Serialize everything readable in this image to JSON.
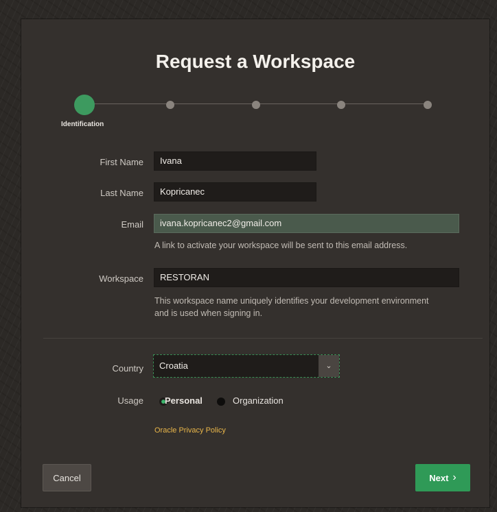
{
  "dialog": {
    "title": "Request a Workspace"
  },
  "wizard": {
    "current_step_label": "Identification",
    "total_steps": 5,
    "current_step": 1
  },
  "form": {
    "first_name": {
      "label": "First Name",
      "value": "Ivana"
    },
    "last_name": {
      "label": "Last Name",
      "value": "Kopricanec"
    },
    "email": {
      "label": "Email",
      "value": "ivana.kopricanec2@gmail.com",
      "help": "A link to activate your workspace will be sent to this email address."
    },
    "workspace": {
      "label": "Workspace",
      "value": "RESTORAN",
      "help_line1": "This workspace name uniquely identifies your development environment",
      "help_line2": "and is used when signing in."
    },
    "country": {
      "label": "Country",
      "value": "Croatia"
    },
    "usage": {
      "label": "Usage",
      "options": [
        "Personal",
        "Organization"
      ],
      "selected": "Personal"
    },
    "privacy_link": "Oracle Privacy Policy"
  },
  "buttons": {
    "cancel": "Cancel",
    "next": "Next",
    "next_icon": "chevron-right-icon"
  },
  "colors": {
    "accent": "#2f9a57",
    "link": "#e9b64a",
    "background": "#34302d"
  }
}
